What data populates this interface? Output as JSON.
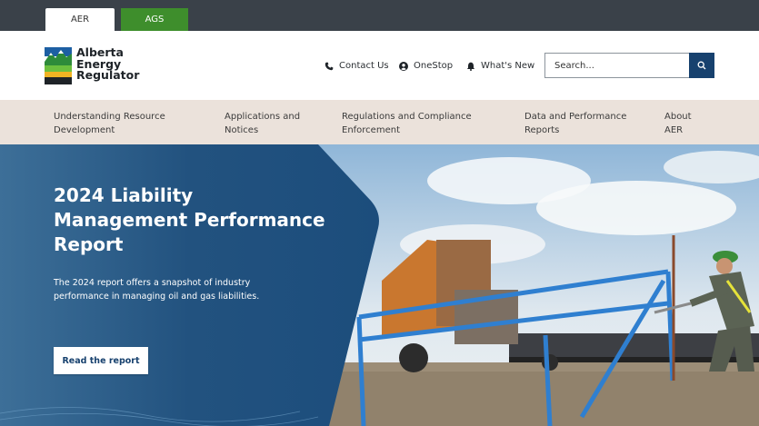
{
  "colors": {
    "topbar": "#3a4149",
    "ags_green": "#3e8e2c",
    "navy": "#17416e",
    "nav_bg": "#ebe2db"
  },
  "tabs": [
    {
      "label": "AER",
      "active": true
    },
    {
      "label": "AGS",
      "active": false
    }
  ],
  "logo": {
    "line1": "Alberta",
    "line2": "Energy",
    "line3": "Regulator"
  },
  "utility": {
    "contact": {
      "label": "Contact Us",
      "icon": "phone-icon"
    },
    "onestop": {
      "label": "OneStop",
      "icon": "user-circle-icon"
    },
    "whatsnew": {
      "label": "What's New",
      "icon": "bell-icon"
    }
  },
  "search": {
    "placeholder": "Search...",
    "icon": "search-icon"
  },
  "nav": [
    {
      "label": "Understanding Resource\nDevelopment"
    },
    {
      "label": "Applications and\nNotices"
    },
    {
      "label": "Regulations and Compliance\nEnforcement"
    },
    {
      "label": "Data and Performance\nReports"
    },
    {
      "label": "About\nAER"
    }
  ],
  "hero": {
    "title": "2024 Liability Management Performance Report",
    "description": "The 2024 report offers a snapshot of industry performance in managing oil and gas liabilities.",
    "cta": "Read the report"
  }
}
